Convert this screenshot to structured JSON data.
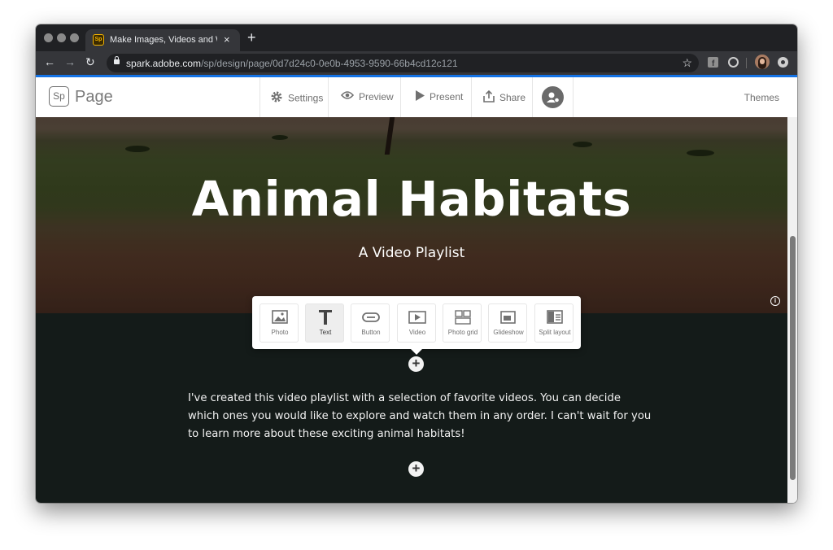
{
  "browser": {
    "tab_title": "Make Images, Videos and Web S",
    "tab_favicon": "Sp",
    "tab_close": "×",
    "new_tab": "+",
    "url_host": "spark.adobe.com",
    "url_path": "/sp/design/page/0d7d24c0-0e0b-4953-9590-66b4cd12c121"
  },
  "app": {
    "logo": "Sp",
    "name": "Page",
    "settings": "Settings",
    "preview": "Preview",
    "present": "Present",
    "share": "Share",
    "themes": "Themes",
    "accent": "#1473e6"
  },
  "hero": {
    "title": "Animal Habitats",
    "subtitle": "A Video Playlist"
  },
  "insert_menu": {
    "items": [
      {
        "label": "Photo",
        "icon": "photo-icon"
      },
      {
        "label": "Text",
        "icon": "text-icon"
      },
      {
        "label": "Button",
        "icon": "button-icon"
      },
      {
        "label": "Video",
        "icon": "video-icon"
      },
      {
        "label": "Photo grid",
        "icon": "photo-grid-icon"
      },
      {
        "label": "Glideshow",
        "icon": "glideshow-icon"
      },
      {
        "label": "Split layout",
        "icon": "split-layout-icon"
      }
    ],
    "selected": "Text"
  },
  "body_text": "I've created this video playlist with a selection of favorite videos. You can decide which ones you would like to explore and watch them in any order. I can't wait for you to learn more about these exciting animal habitats!"
}
